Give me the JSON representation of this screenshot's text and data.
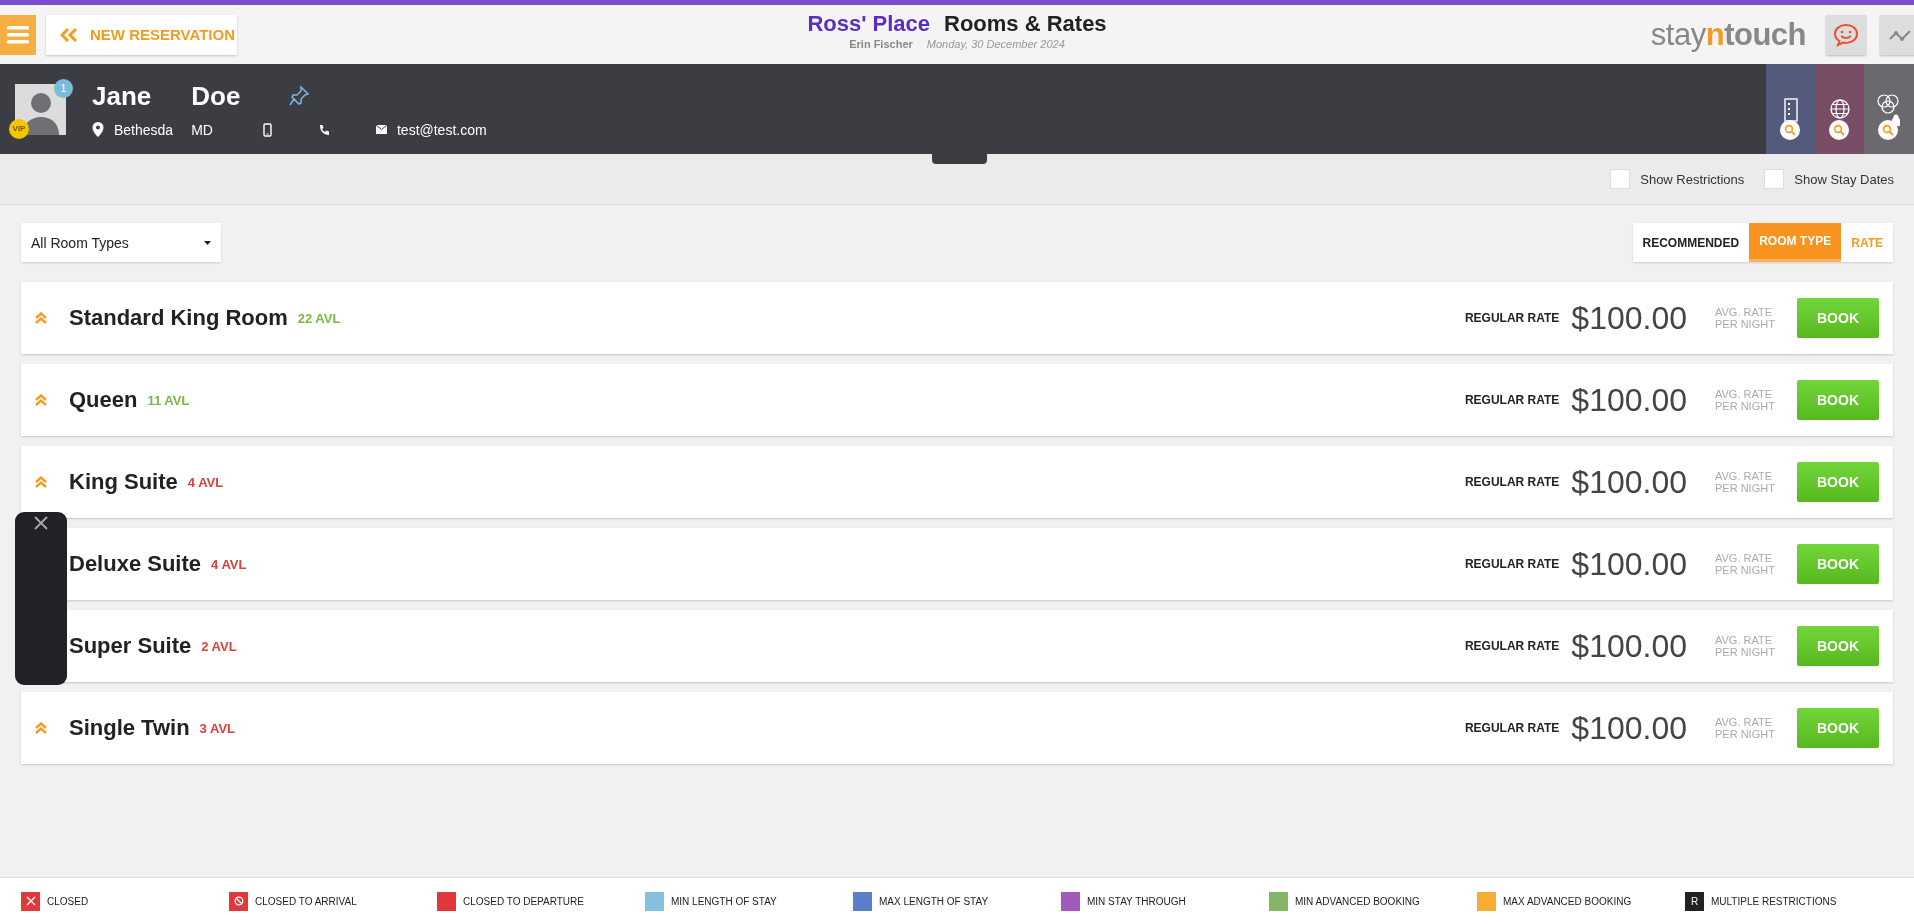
{
  "header": {
    "new_reservation": "NEW RESERVATION",
    "property": "Ross' Place",
    "title": "Rooms & Rates",
    "user": "Erin Fischer",
    "date": "Monday, 30 December 2024",
    "logo": {
      "first": "stay",
      "middle": "n",
      "last": "touch"
    }
  },
  "guest": {
    "first_name": "Jane",
    "last_name": "Doe",
    "badge": "1",
    "vip": "VIP",
    "city": "Bethesda",
    "state": "MD",
    "email": "test@test.com"
  },
  "options": [
    {
      "label": "Show Restrictions",
      "checked": false
    },
    {
      "label": "Show Stay Dates",
      "checked": false
    }
  ],
  "filter": {
    "value": "All Room Types"
  },
  "sort_tabs": [
    {
      "label": "RECOMMENDED",
      "selected": false
    },
    {
      "label": "ROOM TYPE",
      "selected": true
    },
    {
      "label": "RATE",
      "selected": false
    }
  ],
  "rooms": [
    {
      "name": "Standard King Room",
      "availability": "22 AVL",
      "color": "#7ab648",
      "chevron": true,
      "rate_label": "REGULAR RATE",
      "price": "$100.00",
      "price_note": "AVG. RATE PER NIGHT",
      "action": "BOOK"
    },
    {
      "name": "Queen",
      "availability": "11 AVL",
      "color": "#7ab648",
      "chevron": true,
      "rate_label": "REGULAR RATE",
      "price": "$100.00",
      "price_note": "AVG. RATE PER NIGHT",
      "action": "BOOK"
    },
    {
      "name": "King Suite",
      "availability": "4 AVL",
      "color": "#d9413a",
      "chevron": true,
      "rate_label": "REGULAR RATE",
      "price": "$100.00",
      "price_note": "AVG. RATE PER NIGHT",
      "action": "BOOK"
    },
    {
      "name": "Deluxe Suite",
      "availability": "4 AVL",
      "color": "#d9413a",
      "chevron": false,
      "rate_label": "REGULAR RATE",
      "price": "$100.00",
      "price_note": "AVG. RATE PER NIGHT",
      "action": "BOOK"
    },
    {
      "name": "Super Suite",
      "availability": "2 AVL",
      "color": "#d9413a",
      "chevron": false,
      "rate_label": "REGULAR RATE",
      "price": "$100.00",
      "price_note": "AVG. RATE PER NIGHT",
      "action": "BOOK"
    },
    {
      "name": "Single Twin",
      "availability": "3 AVL",
      "color": "#d9413a",
      "chevron": true,
      "rate_label": "REGULAR RATE",
      "price": "$100.00",
      "price_note": "AVG. RATE PER NIGHT",
      "action": "BOOK"
    }
  ],
  "legend": [
    {
      "kind": "cross",
      "label": "CLOSED",
      "color": "#e0383b"
    },
    {
      "kind": "blocked",
      "label": "CLOSED TO ARRIVAL",
      "color": "#e0383b"
    },
    {
      "kind": "plain",
      "label": "CLOSED TO DEPARTURE",
      "color": "#e0383b"
    },
    {
      "kind": "plain",
      "label": "MIN LENGTH OF STAY",
      "color": "#85c1dc"
    },
    {
      "kind": "plain",
      "label": "MAX LENGTH OF STAY",
      "color": "#5b7fcb"
    },
    {
      "kind": "plain",
      "label": "MIN STAY THROUGH",
      "color": "#a25bbd"
    },
    {
      "kind": "plain",
      "label": "MIN ADVANCED BOOKING",
      "color": "#84b765"
    },
    {
      "kind": "plain",
      "label": "MAX ADVANCED BOOKING",
      "color": "#f6ad34"
    },
    {
      "kind": "letter",
      "label": "MULTIPLE RESTRICTIONS",
      "color": "#222222",
      "letter": "R"
    }
  ]
}
